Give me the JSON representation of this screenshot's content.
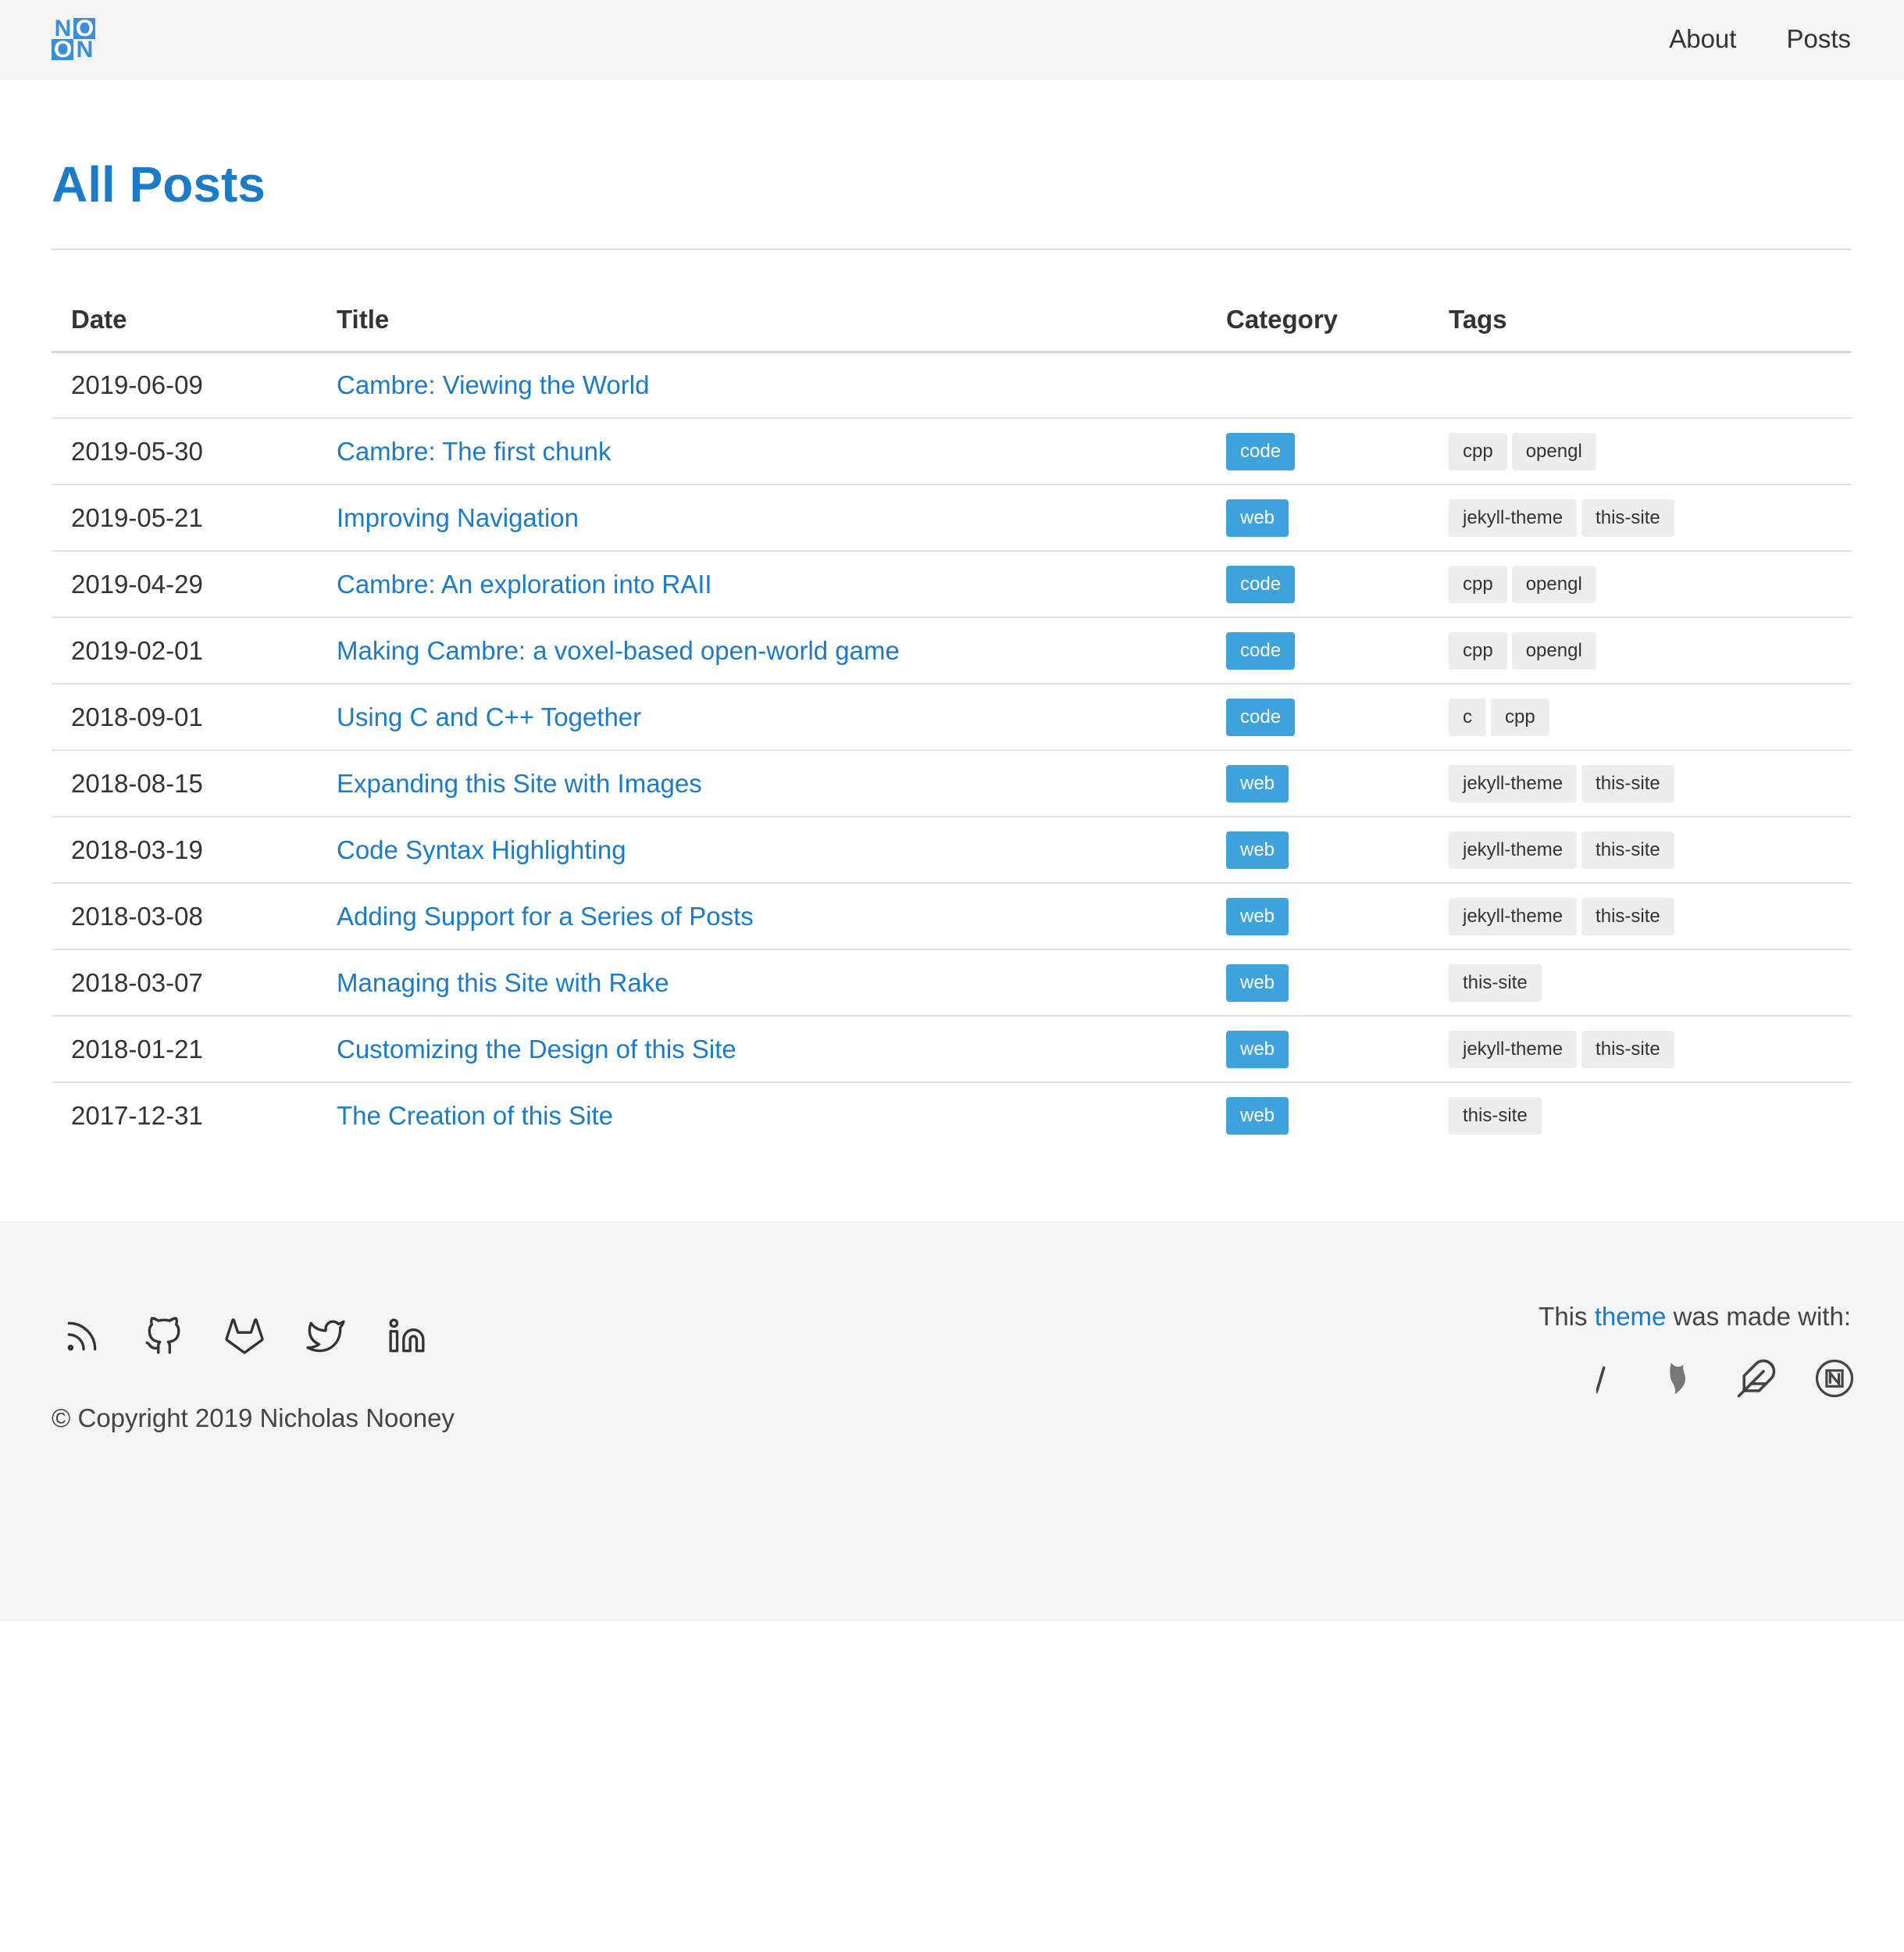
{
  "header": {
    "logo_letters": [
      "N",
      "O",
      "O",
      "N"
    ],
    "nav": [
      {
        "label": "About"
      },
      {
        "label": "Posts"
      }
    ]
  },
  "main": {
    "title": "All Posts",
    "columns": [
      "Date",
      "Title",
      "Category",
      "Tags"
    ],
    "posts": [
      {
        "date": "2019-06-09",
        "title": "Cambre: Viewing the World",
        "category": "",
        "tags": []
      },
      {
        "date": "2019-05-30",
        "title": "Cambre: The first chunk",
        "category": "code",
        "tags": [
          "cpp",
          "opengl"
        ]
      },
      {
        "date": "2019-05-21",
        "title": "Improving Navigation",
        "category": "web",
        "tags": [
          "jekyll-theme",
          "this-site"
        ]
      },
      {
        "date": "2019-04-29",
        "title": "Cambre: An exploration into RAII",
        "category": "code",
        "tags": [
          "cpp",
          "opengl"
        ]
      },
      {
        "date": "2019-02-01",
        "title": "Making Cambre: a voxel-based open-world game",
        "category": "code",
        "tags": [
          "cpp",
          "opengl"
        ]
      },
      {
        "date": "2018-09-01",
        "title": "Using C and C++ Together",
        "category": "code",
        "tags": [
          "c",
          "cpp"
        ]
      },
      {
        "date": "2018-08-15",
        "title": "Expanding this Site with Images",
        "category": "web",
        "tags": [
          "jekyll-theme",
          "this-site"
        ]
      },
      {
        "date": "2018-03-19",
        "title": "Code Syntax Highlighting",
        "category": "web",
        "tags": [
          "jekyll-theme",
          "this-site"
        ]
      },
      {
        "date": "2018-03-08",
        "title": "Adding Support for a Series of Posts",
        "category": "web",
        "tags": [
          "jekyll-theme",
          "this-site"
        ]
      },
      {
        "date": "2018-03-07",
        "title": "Managing this Site with Rake",
        "category": "web",
        "tags": [
          "this-site"
        ]
      },
      {
        "date": "2018-01-21",
        "title": "Customizing the Design of this Site",
        "category": "web",
        "tags": [
          "jekyll-theme",
          "this-site"
        ]
      },
      {
        "date": "2017-12-31",
        "title": "The Creation of this Site",
        "category": "web",
        "tags": [
          "this-site"
        ]
      }
    ]
  },
  "footer": {
    "social_icons": [
      "rss-icon",
      "github-icon",
      "gitlab-icon",
      "twitter-icon",
      "linkedin-icon"
    ],
    "copyright": "© Copyright 2019 Nicholas Nooney",
    "made_prefix": "This ",
    "made_link": "theme",
    "made_suffix": " was made with:",
    "made_icons": [
      "pencil-icon",
      "bootstrap-icon",
      "feather-icon",
      "netlify-icon"
    ]
  },
  "colors": {
    "accent": "#1a7bc9",
    "category_badge": "#3ea3dd",
    "tag_bg": "#ededed",
    "bar_bg": "#f4f4f4"
  }
}
